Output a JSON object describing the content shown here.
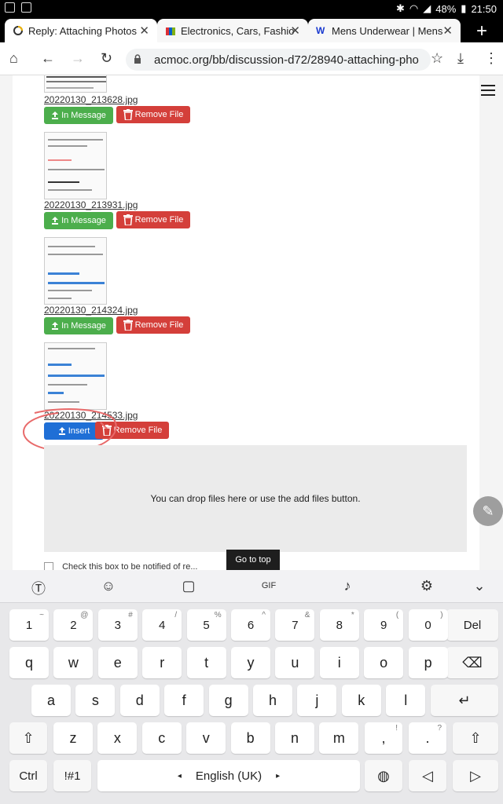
{
  "status_bar": {
    "battery": "48%",
    "time": "21:50"
  },
  "tabs": [
    {
      "title": "Reply: Attaching Photos",
      "close": "✕"
    },
    {
      "title": "Electronics, Cars, Fashio",
      "close": "✕"
    },
    {
      "title": "Mens Underwear | Mens",
      "close": "✕"
    }
  ],
  "new_tab": "+",
  "toolbar": {
    "url": "acmoc.org/bb/discussion-d72/28940-attaching-pho"
  },
  "attachments": [
    {
      "filename": "20220130_213628.jpg",
      "primary_btn": "In Message",
      "remove_btn": "Remove File"
    },
    {
      "filename": "20220130_213931.jpg",
      "primary_btn": "In Message",
      "remove_btn": "Remove File"
    },
    {
      "filename": "20220130_214324.jpg",
      "primary_btn": "In Message",
      "remove_btn": "Remove File"
    },
    {
      "filename": "20220130_214533.jpg",
      "primary_btn": "Insert",
      "remove_btn": "Remove File"
    }
  ],
  "dropzone_text": "You can drop files here or use the add files button.",
  "subscribe_text": "Check this box to be notified of re...",
  "go_to_top": "Go to top",
  "keyboard": {
    "row_numbers": [
      {
        "k": "1",
        "s": "~"
      },
      {
        "k": "2",
        "s": "@"
      },
      {
        "k": "3",
        "s": "#"
      },
      {
        "k": "4",
        "s": "/"
      },
      {
        "k": "5",
        "s": "%"
      },
      {
        "k": "6",
        "s": "^"
      },
      {
        "k": "7",
        "s": "&"
      },
      {
        "k": "8",
        "s": "*"
      },
      {
        "k": "9",
        "s": "("
      },
      {
        "k": "0",
        "s": ")"
      }
    ],
    "del": "Del",
    "row_q": [
      "q",
      "w",
      "e",
      "r",
      "t",
      "y",
      "u",
      "i",
      "o",
      "p"
    ],
    "row_a": [
      "a",
      "s",
      "d",
      "f",
      "g",
      "h",
      "j",
      "k",
      "l"
    ],
    "row_z": [
      "z",
      "x",
      "c",
      "v",
      "b",
      "n",
      "m"
    ],
    "comma": ",",
    "comma_sup": "!",
    "period": ".",
    "period_sup": "?",
    "ctrl": "Ctrl",
    "sym": "!#1",
    "language": "English (UK)"
  },
  "colors": {
    "green": "#4cae4c",
    "red": "#d43f3a",
    "blue": "#1f6fd6",
    "annotation": "#e86a6a"
  }
}
